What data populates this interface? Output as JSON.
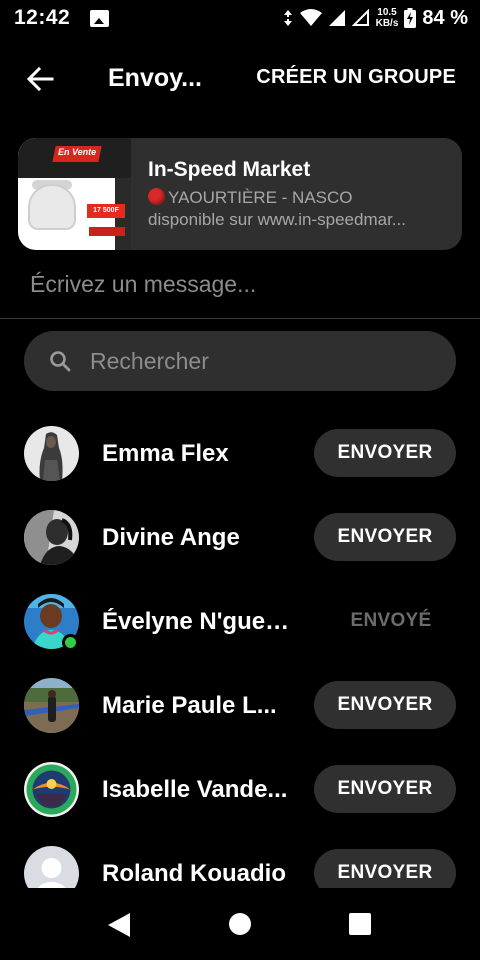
{
  "status_bar": {
    "time": "12:42",
    "net_speed_value": "10.5",
    "net_speed_unit": "KB/s",
    "battery": "84 %"
  },
  "header": {
    "title": "Envoy...",
    "create_group": "CRÉER UN GROUPE"
  },
  "shared_item": {
    "title": "In-Speed Market",
    "subtitle": "YAOURTIÈRE - NASCO",
    "description": "disponible sur www.in-speedmar...",
    "thumb_tag": "En Vente",
    "thumb_price": "17 500F"
  },
  "message": {
    "placeholder": "Écrivez un message..."
  },
  "search": {
    "placeholder": "Rechercher"
  },
  "contacts": [
    {
      "name": "Emma Flex",
      "action": "ENVOYER",
      "sent": false,
      "online": false
    },
    {
      "name": "Divine Ange",
      "action": "ENVOYER",
      "sent": false,
      "online": false
    },
    {
      "name": "Évelyne N'gues...",
      "action": "ENVOYÉ",
      "sent": true,
      "online": true
    },
    {
      "name": "Marie Paule L...",
      "action": "ENVOYER",
      "sent": false,
      "online": false
    },
    {
      "name": "Isabelle Vande...",
      "action": "ENVOYER",
      "sent": false,
      "online": false
    },
    {
      "name": "Roland Kouadio",
      "action": "ENVOYER",
      "sent": false,
      "online": false
    }
  ],
  "colors": {
    "background": "#000000",
    "surface": "#2f2f2f",
    "online": "#31cc46",
    "muted_text": "#8c8c8c"
  }
}
